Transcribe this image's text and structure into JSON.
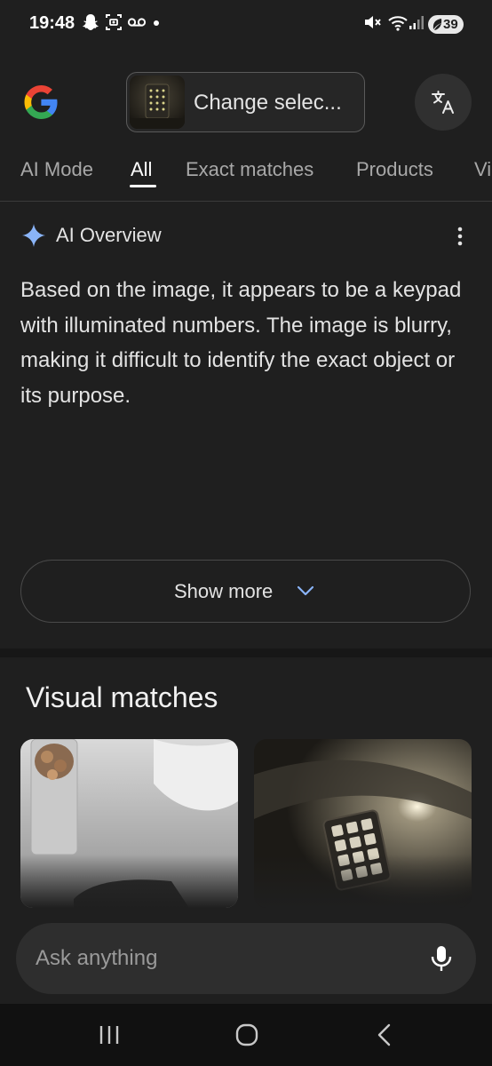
{
  "status_bar": {
    "time": "19:48",
    "battery": "39",
    "left_icons": [
      "snapchat-icon",
      "screenshot-icon",
      "voicemail-icon",
      "dot-icon"
    ],
    "right_icons": [
      "mute-icon",
      "wifi-icon",
      "signal-icon",
      "battery-icon"
    ]
  },
  "header": {
    "logo": "google-logo",
    "change_selection_label": "Change selec...",
    "translate_icon": "translate-icon"
  },
  "tabs": [
    {
      "label": "AI Mode",
      "active": false
    },
    {
      "label": "All",
      "active": true
    },
    {
      "label": "Exact matches",
      "active": false
    },
    {
      "label": "Products",
      "active": false
    },
    {
      "label": "Vi",
      "active": false
    }
  ],
  "ai_overview": {
    "title": "AI Overview",
    "body": "Based on the image, it appears to be a keypad with illuminated numbers. The image is blurry, making it difficult to identify the exact object or its purpose.",
    "show_more_label": "Show more"
  },
  "visual_matches": {
    "title": "Visual matches"
  },
  "ask_bar": {
    "placeholder": "Ask anything"
  },
  "nav_bar": {
    "buttons": [
      "recents-icon",
      "home-icon",
      "back-icon"
    ]
  },
  "colors": {
    "background": "#1f1f1f",
    "text": "#e3e3e3",
    "muted_text": "#a8a8a8",
    "sparkle": "#8ab4f8",
    "google_blue": "#4285f4",
    "google_red": "#ea4335",
    "google_yellow": "#fbbc05",
    "google_green": "#34a853"
  }
}
